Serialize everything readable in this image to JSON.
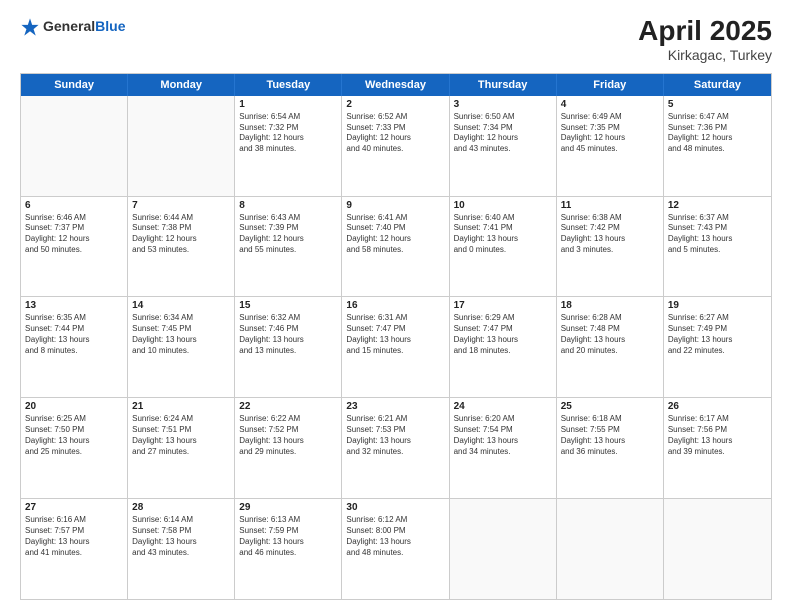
{
  "header": {
    "logo_general": "General",
    "logo_blue": "Blue",
    "title": "April 2025",
    "location": "Kirkagac, Turkey"
  },
  "weekdays": [
    "Sunday",
    "Monday",
    "Tuesday",
    "Wednesday",
    "Thursday",
    "Friday",
    "Saturday"
  ],
  "rows": [
    [
      {
        "day": "",
        "info": ""
      },
      {
        "day": "",
        "info": ""
      },
      {
        "day": "1",
        "info": "Sunrise: 6:54 AM\nSunset: 7:32 PM\nDaylight: 12 hours\nand 38 minutes."
      },
      {
        "day": "2",
        "info": "Sunrise: 6:52 AM\nSunset: 7:33 PM\nDaylight: 12 hours\nand 40 minutes."
      },
      {
        "day": "3",
        "info": "Sunrise: 6:50 AM\nSunset: 7:34 PM\nDaylight: 12 hours\nand 43 minutes."
      },
      {
        "day": "4",
        "info": "Sunrise: 6:49 AM\nSunset: 7:35 PM\nDaylight: 12 hours\nand 45 minutes."
      },
      {
        "day": "5",
        "info": "Sunrise: 6:47 AM\nSunset: 7:36 PM\nDaylight: 12 hours\nand 48 minutes."
      }
    ],
    [
      {
        "day": "6",
        "info": "Sunrise: 6:46 AM\nSunset: 7:37 PM\nDaylight: 12 hours\nand 50 minutes."
      },
      {
        "day": "7",
        "info": "Sunrise: 6:44 AM\nSunset: 7:38 PM\nDaylight: 12 hours\nand 53 minutes."
      },
      {
        "day": "8",
        "info": "Sunrise: 6:43 AM\nSunset: 7:39 PM\nDaylight: 12 hours\nand 55 minutes."
      },
      {
        "day": "9",
        "info": "Sunrise: 6:41 AM\nSunset: 7:40 PM\nDaylight: 12 hours\nand 58 minutes."
      },
      {
        "day": "10",
        "info": "Sunrise: 6:40 AM\nSunset: 7:41 PM\nDaylight: 13 hours\nand 0 minutes."
      },
      {
        "day": "11",
        "info": "Sunrise: 6:38 AM\nSunset: 7:42 PM\nDaylight: 13 hours\nand 3 minutes."
      },
      {
        "day": "12",
        "info": "Sunrise: 6:37 AM\nSunset: 7:43 PM\nDaylight: 13 hours\nand 5 minutes."
      }
    ],
    [
      {
        "day": "13",
        "info": "Sunrise: 6:35 AM\nSunset: 7:44 PM\nDaylight: 13 hours\nand 8 minutes."
      },
      {
        "day": "14",
        "info": "Sunrise: 6:34 AM\nSunset: 7:45 PM\nDaylight: 13 hours\nand 10 minutes."
      },
      {
        "day": "15",
        "info": "Sunrise: 6:32 AM\nSunset: 7:46 PM\nDaylight: 13 hours\nand 13 minutes."
      },
      {
        "day": "16",
        "info": "Sunrise: 6:31 AM\nSunset: 7:47 PM\nDaylight: 13 hours\nand 15 minutes."
      },
      {
        "day": "17",
        "info": "Sunrise: 6:29 AM\nSunset: 7:47 PM\nDaylight: 13 hours\nand 18 minutes."
      },
      {
        "day": "18",
        "info": "Sunrise: 6:28 AM\nSunset: 7:48 PM\nDaylight: 13 hours\nand 20 minutes."
      },
      {
        "day": "19",
        "info": "Sunrise: 6:27 AM\nSunset: 7:49 PM\nDaylight: 13 hours\nand 22 minutes."
      }
    ],
    [
      {
        "day": "20",
        "info": "Sunrise: 6:25 AM\nSunset: 7:50 PM\nDaylight: 13 hours\nand 25 minutes."
      },
      {
        "day": "21",
        "info": "Sunrise: 6:24 AM\nSunset: 7:51 PM\nDaylight: 13 hours\nand 27 minutes."
      },
      {
        "day": "22",
        "info": "Sunrise: 6:22 AM\nSunset: 7:52 PM\nDaylight: 13 hours\nand 29 minutes."
      },
      {
        "day": "23",
        "info": "Sunrise: 6:21 AM\nSunset: 7:53 PM\nDaylight: 13 hours\nand 32 minutes."
      },
      {
        "day": "24",
        "info": "Sunrise: 6:20 AM\nSunset: 7:54 PM\nDaylight: 13 hours\nand 34 minutes."
      },
      {
        "day": "25",
        "info": "Sunrise: 6:18 AM\nSunset: 7:55 PM\nDaylight: 13 hours\nand 36 minutes."
      },
      {
        "day": "26",
        "info": "Sunrise: 6:17 AM\nSunset: 7:56 PM\nDaylight: 13 hours\nand 39 minutes."
      }
    ],
    [
      {
        "day": "27",
        "info": "Sunrise: 6:16 AM\nSunset: 7:57 PM\nDaylight: 13 hours\nand 41 minutes."
      },
      {
        "day": "28",
        "info": "Sunrise: 6:14 AM\nSunset: 7:58 PM\nDaylight: 13 hours\nand 43 minutes."
      },
      {
        "day": "29",
        "info": "Sunrise: 6:13 AM\nSunset: 7:59 PM\nDaylight: 13 hours\nand 46 minutes."
      },
      {
        "day": "30",
        "info": "Sunrise: 6:12 AM\nSunset: 8:00 PM\nDaylight: 13 hours\nand 48 minutes."
      },
      {
        "day": "",
        "info": ""
      },
      {
        "day": "",
        "info": ""
      },
      {
        "day": "",
        "info": ""
      }
    ]
  ]
}
